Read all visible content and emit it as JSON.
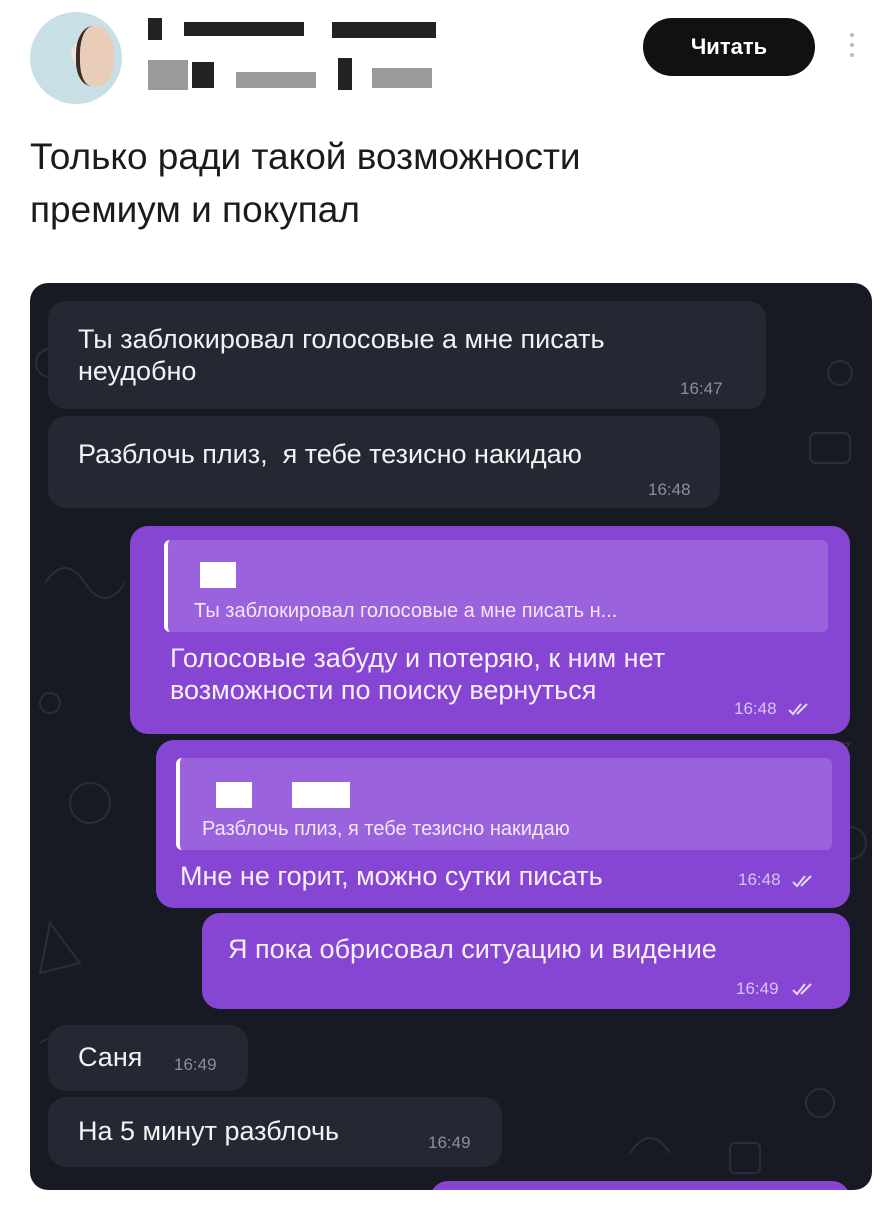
{
  "header": {
    "read_button": "Читать"
  },
  "post": {
    "text": "Только ради такой возможности\nпремиум и покупал"
  },
  "chat": {
    "messages": [
      {
        "dir": "in",
        "text": "Ты заблокировал голосовые а мне писать\nнеудобно",
        "time": "16:47"
      },
      {
        "dir": "in",
        "text": "Разблочь плиз,  я тебе тезисно накидаю",
        "time": "16:48"
      },
      {
        "dir": "out",
        "reply_to": "Ты заблокировал голосовые а мне писать н...",
        "text": "Голосовые забуду и потеряю, к ним нет\nвозможности по поиску вернуться",
        "time": "16:48"
      },
      {
        "dir": "out",
        "reply_to": "Разблочь плиз,  я тебе тезисно накидаю",
        "text": "Мне не горит, можно сутки писать",
        "time": "16:48"
      },
      {
        "dir": "out",
        "text": "Я пока обрисовал ситуацию и видение",
        "time": "16:49"
      },
      {
        "dir": "in",
        "text": "Саня",
        "time": "16:49"
      },
      {
        "dir": "in",
        "text": "На 5 минут разблочь",
        "time": "16:49"
      }
    ]
  },
  "colors": {
    "chat_bg": "#171a22",
    "incoming_bubble": "#252833",
    "outgoing_bubble": "#8646d3",
    "read_button_bg": "#111111"
  },
  "icons": [
    "more-vertical-icon",
    "double-check-icon"
  ]
}
